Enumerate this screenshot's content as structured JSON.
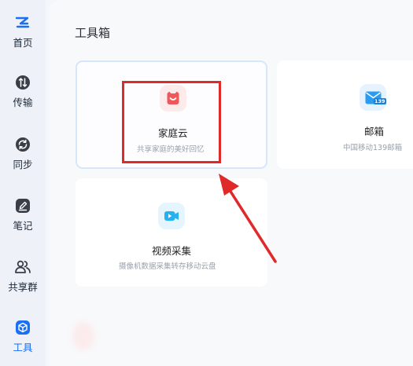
{
  "sidebar": {
    "items": [
      {
        "label": "首页",
        "icon": "cloud-logo-icon",
        "active": false
      },
      {
        "label": "传输",
        "icon": "transfer-icon",
        "active": false
      },
      {
        "label": "同步",
        "icon": "sync-icon",
        "active": false
      },
      {
        "label": "笔记",
        "icon": "note-pen-icon",
        "active": false
      },
      {
        "label": "共享群",
        "icon": "group-icon",
        "active": false
      },
      {
        "label": "工具",
        "icon": "toolbox-icon",
        "active": true
      }
    ]
  },
  "main": {
    "title": "工具箱",
    "cards": [
      {
        "name": "家庭云",
        "desc": "共享家庭的美好回忆",
        "icon": "family-cloud-icon",
        "highlighted": true
      },
      {
        "name": "邮箱",
        "desc": "中国移动139邮箱",
        "icon": "mail-icon",
        "badge": "139"
      },
      {
        "name": "视频采集",
        "desc": "摄像机数据采集转存移动云盘",
        "icon": "video-capture-icon"
      }
    ]
  },
  "colors": {
    "accent": "#1b6ff5",
    "annotation_red": "#e02a2a",
    "family_cloud": "#f0575a",
    "mail": "#2a9cf4",
    "video": "#24b2f0"
  }
}
